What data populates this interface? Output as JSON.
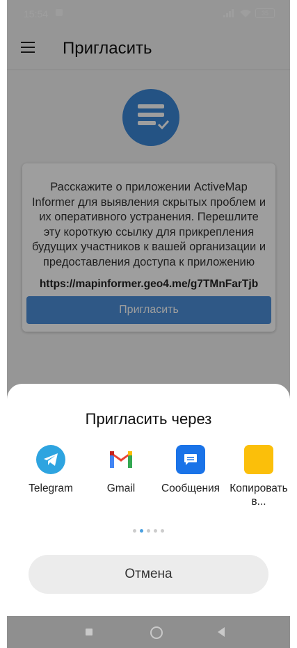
{
  "status_bar": {
    "time": "15:54",
    "battery": "35"
  },
  "app_bar": {
    "title": "Пригласить"
  },
  "card": {
    "description": "Расскажите о приложении ActiveMap Informer для выявления скрытых проблем и их оперативного устранения. Перешлите эту короткую ссылку для прикрепления будущих участников к вашей организации и предоставления доступа к приложению",
    "link": "https://mapinformer.geo4.me/g7TMnFarTjb",
    "button_label": "Пригласить"
  },
  "share_sheet": {
    "title": "Пригласить через",
    "apps": [
      {
        "label": "Telegram",
        "icon": "telegram-icon"
      },
      {
        "label": "Gmail",
        "icon": "gmail-icon"
      },
      {
        "label": "Сообщения",
        "icon": "messages-icon"
      },
      {
        "label": "Копировать в...",
        "icon": "copy-icon"
      }
    ],
    "page_count": 5,
    "active_page": 1,
    "cancel_label": "Отмена"
  },
  "colors": {
    "accent": "#3b86d6",
    "telegram": "#2ea4e0",
    "messages": "#1a73e8",
    "copy": "#fbbf0a"
  }
}
